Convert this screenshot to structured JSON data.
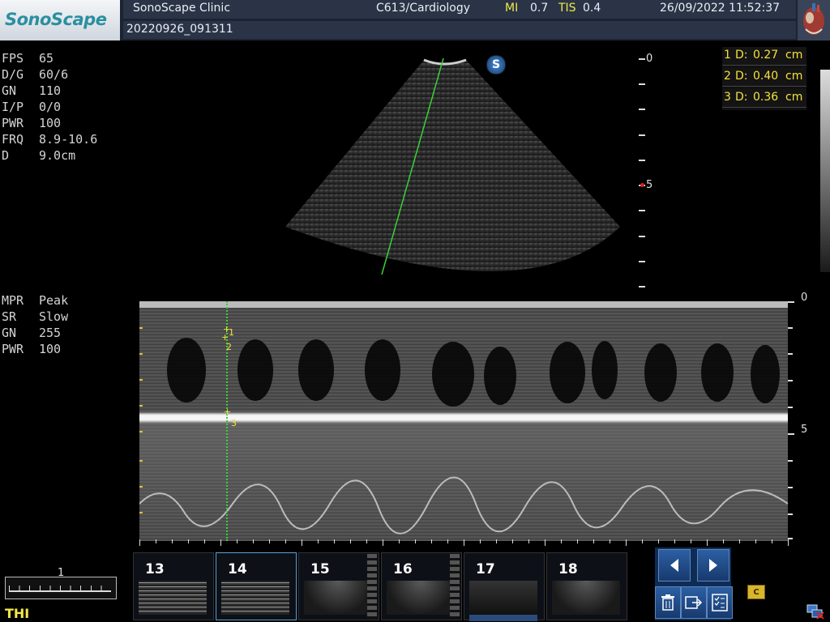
{
  "header": {
    "logo": "SonoScape",
    "clinic": "SonoScape Clinic",
    "probe_preset": "C613/Cardiology",
    "mi_label": "MI",
    "mi_value": "0.7",
    "tis_label": "TIS",
    "tis_value": "0.4",
    "datetime": "26/09/2022 11:52:37",
    "patient_id": "20220926_091311"
  },
  "b_mode_params": [
    {
      "label": "FPS",
      "value": "65"
    },
    {
      "label": "D/G",
      "value": "60/6"
    },
    {
      "label": "GN",
      "value": "110"
    },
    {
      "label": "I/P",
      "value": "0/0"
    },
    {
      "label": "PWR",
      "value": "100"
    },
    {
      "label": "FRQ",
      "value": "8.9-10.6"
    },
    {
      "label": "D",
      "value": "9.0cm"
    }
  ],
  "m_mode_params": [
    {
      "label": "MPR",
      "value": "Peak"
    },
    {
      "label": "SR",
      "value": "Slow"
    },
    {
      "label": "GN",
      "value": "255"
    },
    {
      "label": "PWR",
      "value": "100"
    }
  ],
  "measurements": [
    {
      "index": "1",
      "label": "D:",
      "value": "0.27",
      "unit": "cm"
    },
    {
      "index": "2",
      "label": "D:",
      "value": "0.40",
      "unit": "cm"
    },
    {
      "index": "3",
      "label": "D:",
      "value": "0.36",
      "unit": "cm"
    }
  ],
  "b_scale_labels": {
    "top": "0",
    "mid": "5"
  },
  "m_scale_labels": {
    "top": "0",
    "mid": "5"
  },
  "caliper_labels": [
    "1",
    "2",
    "3"
  ],
  "probe_badge": "S",
  "thumbnails": [
    {
      "num": "13",
      "selected": false
    },
    {
      "num": "14",
      "selected": true
    },
    {
      "num": "15",
      "selected": false
    },
    {
      "num": "16",
      "selected": false
    },
    {
      "num": "17",
      "selected": false
    },
    {
      "num": "18",
      "selected": false
    }
  ],
  "scale_bar_label": "1",
  "mode_indicator": "THI",
  "colors": {
    "header_bg": "#2a3446",
    "accent_yellow": "#f2e84a",
    "measure_text": "#f4e23a",
    "m_line_green": "#39d13a",
    "button_blue": "#2c5fa3"
  },
  "icons": {
    "prev": "chevron-left-icon",
    "next": "chevron-right-icon",
    "delete": "trash-icon",
    "export": "export-icon",
    "report": "checklist-icon",
    "clipboard": "clipboard-icon",
    "network": "network-icon"
  }
}
